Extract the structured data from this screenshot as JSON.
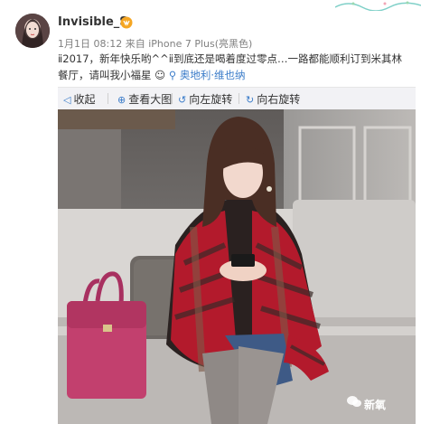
{
  "user": {
    "name": "Invisible_S"
  },
  "post": {
    "time": "1月1日 08:12",
    "source_prefix": "来自",
    "source": "iPhone 7 Plus(亮黑色)",
    "text": "ⅱ2017，新年快乐哟^^ⅱ到底还是喝着度过零点…一路都能顺利订到米其林餐厅，请叫我小福星",
    "location": "奥地利·维也纳"
  },
  "actions": [
    {
      "label": "收起",
      "icon": "collapse-up-icon"
    },
    {
      "label": "查看大图",
      "icon": "zoom-icon"
    },
    {
      "label": "向左旋转",
      "icon": "rotate-left-icon"
    },
    {
      "label": "向右旋转",
      "icon": "rotate-right-icon"
    }
  ],
  "watermark": {
    "text": "新氧"
  },
  "colors": {
    "link": "#3b7cc9",
    "accent_bag": "#c2406e",
    "scarf_red": "#b31a2c",
    "sofa": "#d9d6d3",
    "wall": "#8c8a88"
  }
}
